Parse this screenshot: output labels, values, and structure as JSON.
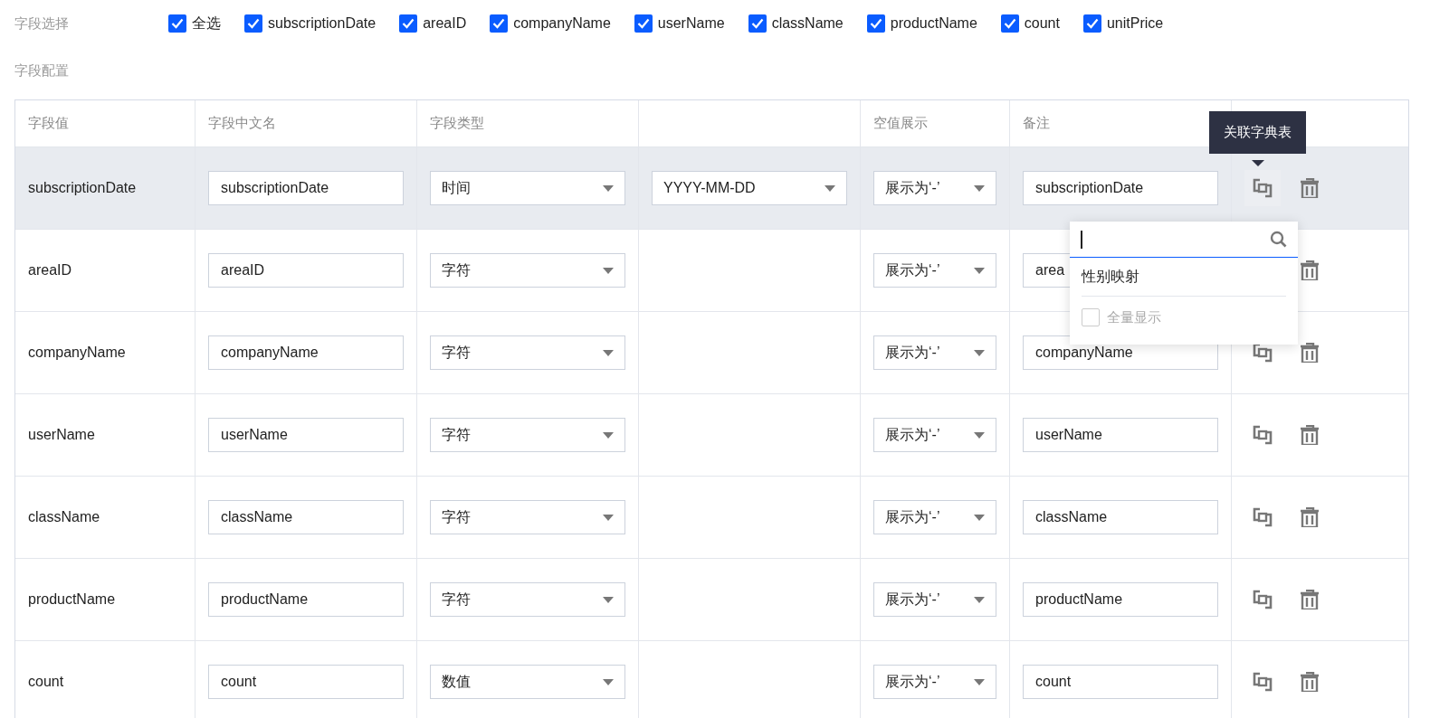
{
  "field_selection": {
    "label": "字段选择",
    "options": [
      {
        "label": "全选",
        "checked": true
      },
      {
        "label": "subscriptionDate",
        "checked": true
      },
      {
        "label": "areaID",
        "checked": true
      },
      {
        "label": "companyName",
        "checked": true
      },
      {
        "label": "userName",
        "checked": true
      },
      {
        "label": "className",
        "checked": true
      },
      {
        "label": "productName",
        "checked": true
      },
      {
        "label": "count",
        "checked": true
      },
      {
        "label": "unitPrice",
        "checked": true
      }
    ]
  },
  "field_config": {
    "label": "字段配置"
  },
  "table": {
    "columns": [
      "字段值",
      "字段中文名",
      "字段类型",
      "",
      "空值展示",
      "备注",
      ""
    ],
    "rows": [
      {
        "field": "subscriptionDate",
        "cn_name": "subscriptionDate",
        "type": "时间",
        "format": "YYYY-MM-DD",
        "null_display": "展示为‘-’",
        "remark": "subscriptionDate",
        "highlighted": true,
        "link_icon": true,
        "hovered": true
      },
      {
        "field": "areaID",
        "cn_name": "areaID",
        "type": "字符",
        "null_display": "展示为‘-’",
        "remark": "area",
        "highlighted": false,
        "link_icon": false,
        "hovered": false
      },
      {
        "field": "companyName",
        "cn_name": "companyName",
        "type": "字符",
        "null_display": "展示为‘-’",
        "remark": "companyName",
        "highlighted": false,
        "link_icon": true,
        "hovered": false
      },
      {
        "field": "userName",
        "cn_name": "userName",
        "type": "字符",
        "null_display": "展示为‘-’",
        "remark": "userName",
        "highlighted": false,
        "link_icon": true,
        "hovered": false
      },
      {
        "field": "className",
        "cn_name": "className",
        "type": "字符",
        "null_display": "展示为‘-’",
        "remark": "className",
        "highlighted": false,
        "link_icon": true,
        "hovered": false
      },
      {
        "field": "productName",
        "cn_name": "productName",
        "type": "字符",
        "null_display": "展示为‘-’",
        "remark": "productName",
        "highlighted": false,
        "link_icon": true,
        "hovered": false
      },
      {
        "field": "count",
        "cn_name": "count",
        "type": "数值",
        "null_display": "展示为‘-’",
        "remark": "count",
        "highlighted": false,
        "link_icon": true,
        "hovered": false
      }
    ]
  },
  "tooltip": {
    "text": "关联字典表"
  },
  "dictionary_popover": {
    "items": [
      "性别映射"
    ],
    "show_all": {
      "label": "全量显示",
      "checked": false,
      "disabled": true
    }
  }
}
